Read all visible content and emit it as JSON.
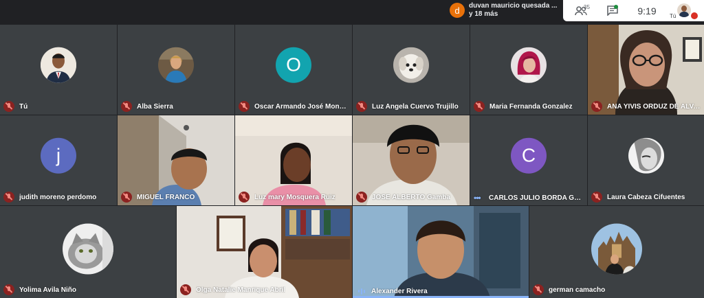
{
  "notification": {
    "avatar_letter": "d",
    "line1": "duvan mauricio quesada ...",
    "line2": "y 18 más"
  },
  "controls": {
    "participant_count": "35",
    "time": "9:19",
    "self_label": "Tú"
  },
  "participants": [
    {
      "name": "Tú",
      "muted": true
    },
    {
      "name": "Alba Sierra",
      "muted": true
    },
    {
      "name": "Oscar Armando José Moncayo...",
      "muted": true,
      "initial": "O"
    },
    {
      "name": "Luz Angela Cuervo Trujillo",
      "muted": true
    },
    {
      "name": "Maria Fernanda Gonzalez",
      "muted": true
    },
    {
      "name": "ANA YIVIS ORDUZ DE ALVAREZ",
      "muted": true
    },
    {
      "name": "judith moreno perdomo",
      "muted": true,
      "initial": "j"
    },
    {
      "name": "MIGUEL FRANCO",
      "muted": true
    },
    {
      "name": "Luz mary Mosquera Ruiz",
      "muted": true
    },
    {
      "name": "JOSE ALBERTO Gamba",
      "muted": true
    },
    {
      "name": "CARLOS JULIO BORDA GAMA",
      "muted": false,
      "initial": "C"
    },
    {
      "name": "Laura Cabeza Cifuentes",
      "muted": true
    },
    {
      "name": "Yolima Avila Niño",
      "muted": true
    },
    {
      "name": "Olga Natalie Manrique Abril",
      "muted": true
    },
    {
      "name": "Alexander Rivera",
      "muted": false,
      "speaking": true
    },
    {
      "name": "german camacho",
      "muted": true
    }
  ],
  "colors": {
    "background": "#202124",
    "tile": "#3c4043",
    "oscar_avatar": "#12a4af",
    "judith_avatar": "#5c6bc0",
    "carlos_avatar": "#7e57c2",
    "notification_avatar": "#e8710a",
    "active_speaker": "#8ab4f8",
    "mic_off": "#8b2220"
  },
  "icons": {
    "people": "people-icon",
    "chat": "chat-icon",
    "mic_off": "mic-off-icon",
    "more": "more-dots-icon",
    "speaking": "audio-level-icon"
  }
}
